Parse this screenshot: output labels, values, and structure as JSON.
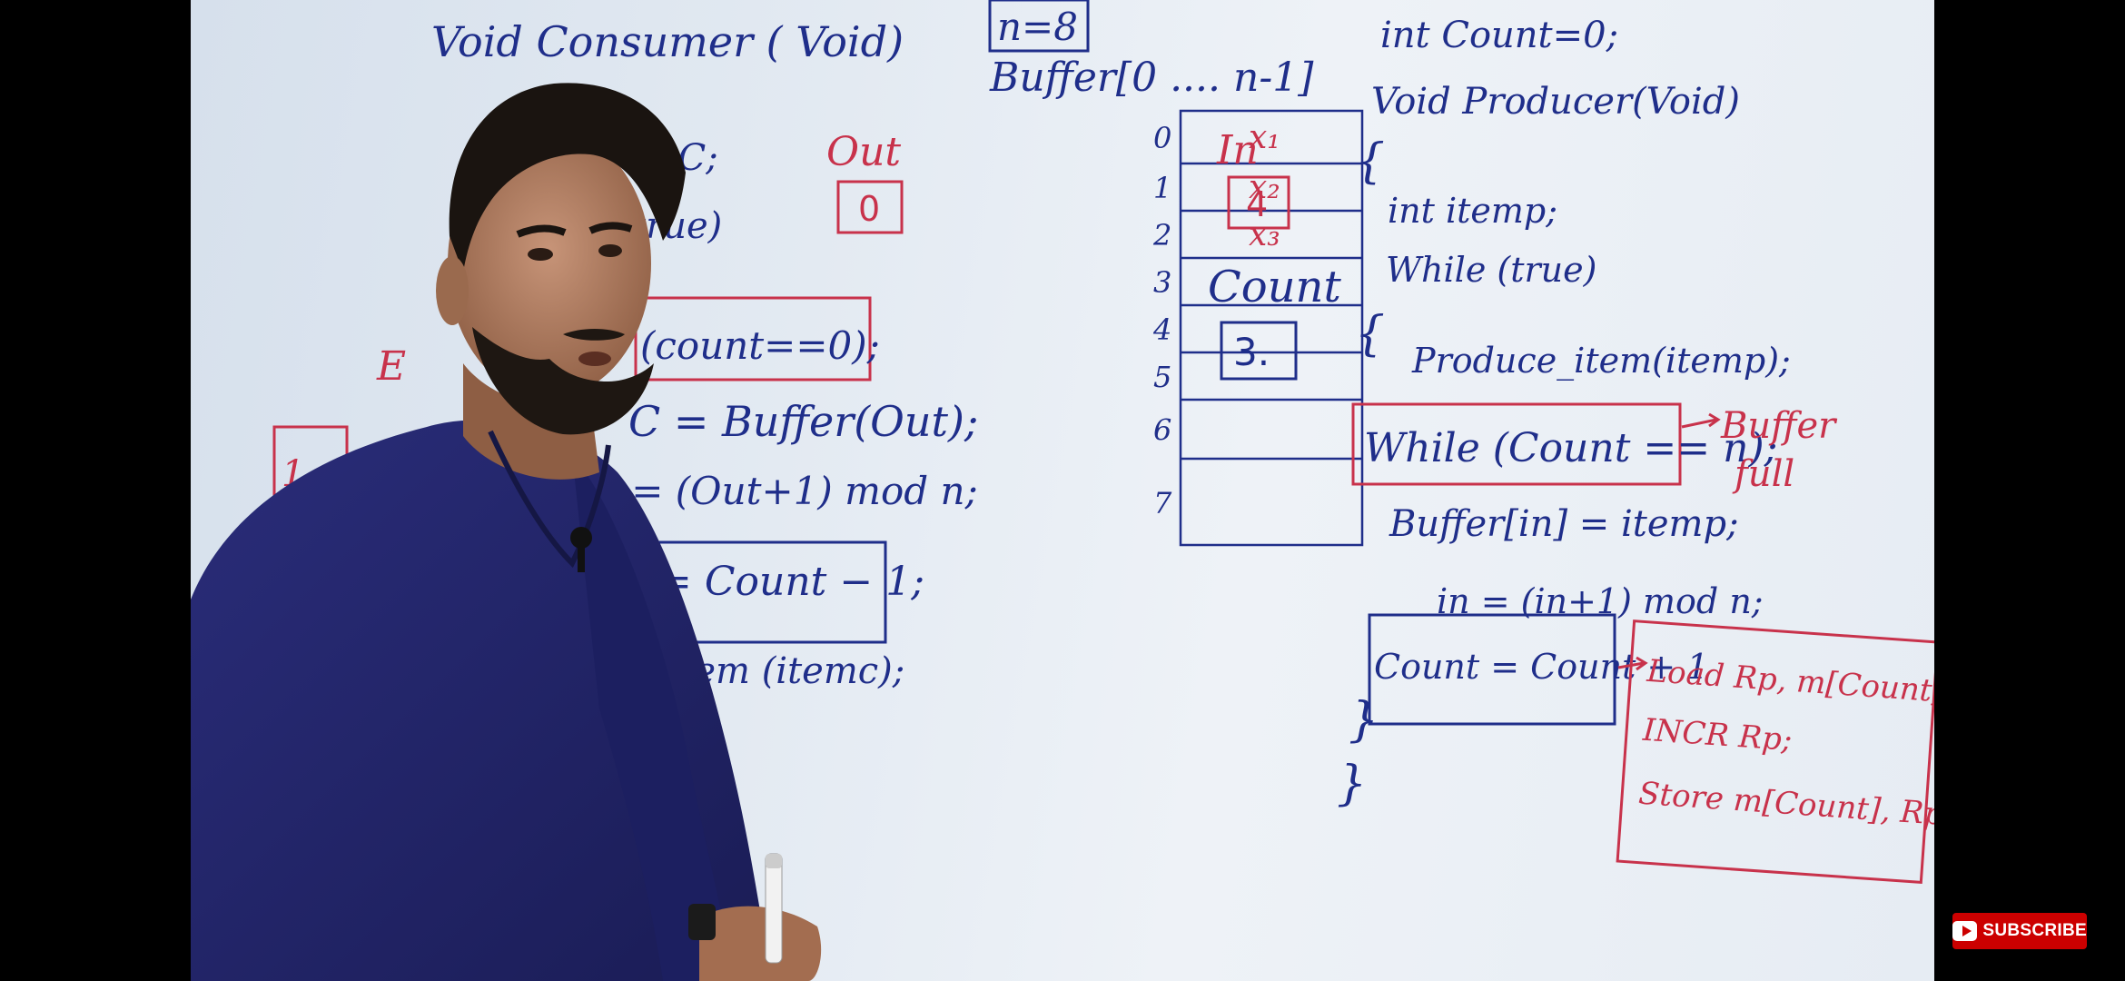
{
  "colors": {
    "blue_ink": "#1f2e8a",
    "red_ink": "#c8324b",
    "subscribe_bg": "#cc0000"
  },
  "consumer": {
    "title": "Void Consumer ( Void)",
    "line_item": "emC;",
    "line_while": "true)",
    "boxed_while": "(count==0);",
    "line_buffer": "C = Buffer(Out);",
    "line_mod": "t = (Out+1) mod n;",
    "boxed_count": "= Count − 1;",
    "line_consume": "-item (itemc);",
    "partial_brace": "E",
    "partial_box": "1"
  },
  "out_label": "Out",
  "out_value": "0",
  "in_label": "In",
  "in_value": "4",
  "count_label": "Count",
  "count_value": "3.",
  "buffer": {
    "n_label": "n=8",
    "decl": "Buffer[0 .... n-1]",
    "indices": [
      "0",
      "1",
      "2",
      "3",
      "4",
      "5",
      "6",
      "7"
    ],
    "cells": [
      "x₁",
      "x₂",
      "x₃",
      "",
      "",
      "",
      "",
      ""
    ]
  },
  "producer": {
    "line_int_count": "int Count=0;",
    "title": "Void Producer(Void)",
    "brace_open1": "{",
    "line_int_item": "int itemp;",
    "line_while": "While (true)",
    "brace_open2": "{",
    "line_produce": "Produce_item(itemp);",
    "boxed_while": "While (Count == n);",
    "note_buffer_full_1": "Buffer",
    "note_buffer_full_2": "full",
    "line_buffer": "Buffer[in] = itemp;",
    "line_mod": "in = (in+1) mod n;",
    "boxed_count": "Count = Count + 1",
    "asm_1": "Load Rp, m[Count];",
    "asm_2": "INCR Rp;",
    "asm_3": "Store m[Count], Rp;",
    "brace_close1": "}",
    "brace_close2": "}"
  },
  "presenter": {
    "name": "presenter"
  },
  "subscribe": {
    "label": "SUBSCRIBE",
    "icon": "youtube-play-icon"
  }
}
